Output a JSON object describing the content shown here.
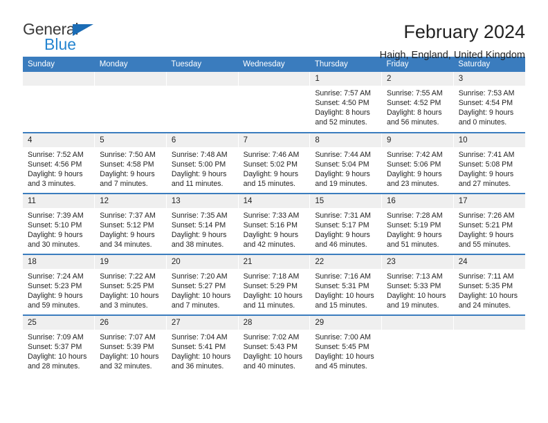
{
  "brand": {
    "name_top": "General",
    "name_bottom": "Blue",
    "triangle_color": "#1b6cb5",
    "blue_color": "#2585d0"
  },
  "header": {
    "title": "February 2024",
    "subtitle": "Haigh, England, United Kingdom"
  },
  "theme": {
    "header_bg": "#3a7cbe",
    "daynum_bg": "#efefef",
    "text": "#222222"
  },
  "weekday_headers": [
    "Sunday",
    "Monday",
    "Tuesday",
    "Wednesday",
    "Thursday",
    "Friday",
    "Saturday"
  ],
  "weeks": [
    [
      {
        "day": "",
        "sunrise": "",
        "sunset": "",
        "daylight_1": "",
        "daylight_2": ""
      },
      {
        "day": "",
        "sunrise": "",
        "sunset": "",
        "daylight_1": "",
        "daylight_2": ""
      },
      {
        "day": "",
        "sunrise": "",
        "sunset": "",
        "daylight_1": "",
        "daylight_2": ""
      },
      {
        "day": "",
        "sunrise": "",
        "sunset": "",
        "daylight_1": "",
        "daylight_2": ""
      },
      {
        "day": "1",
        "sunrise": "Sunrise: 7:57 AM",
        "sunset": "Sunset: 4:50 PM",
        "daylight_1": "Daylight: 8 hours",
        "daylight_2": "and 52 minutes."
      },
      {
        "day": "2",
        "sunrise": "Sunrise: 7:55 AM",
        "sunset": "Sunset: 4:52 PM",
        "daylight_1": "Daylight: 8 hours",
        "daylight_2": "and 56 minutes."
      },
      {
        "day": "3",
        "sunrise": "Sunrise: 7:53 AM",
        "sunset": "Sunset: 4:54 PM",
        "daylight_1": "Daylight: 9 hours",
        "daylight_2": "and 0 minutes."
      }
    ],
    [
      {
        "day": "4",
        "sunrise": "Sunrise: 7:52 AM",
        "sunset": "Sunset: 4:56 PM",
        "daylight_1": "Daylight: 9 hours",
        "daylight_2": "and 3 minutes."
      },
      {
        "day": "5",
        "sunrise": "Sunrise: 7:50 AM",
        "sunset": "Sunset: 4:58 PM",
        "daylight_1": "Daylight: 9 hours",
        "daylight_2": "and 7 minutes."
      },
      {
        "day": "6",
        "sunrise": "Sunrise: 7:48 AM",
        "sunset": "Sunset: 5:00 PM",
        "daylight_1": "Daylight: 9 hours",
        "daylight_2": "and 11 minutes."
      },
      {
        "day": "7",
        "sunrise": "Sunrise: 7:46 AM",
        "sunset": "Sunset: 5:02 PM",
        "daylight_1": "Daylight: 9 hours",
        "daylight_2": "and 15 minutes."
      },
      {
        "day": "8",
        "sunrise": "Sunrise: 7:44 AM",
        "sunset": "Sunset: 5:04 PM",
        "daylight_1": "Daylight: 9 hours",
        "daylight_2": "and 19 minutes."
      },
      {
        "day": "9",
        "sunrise": "Sunrise: 7:42 AM",
        "sunset": "Sunset: 5:06 PM",
        "daylight_1": "Daylight: 9 hours",
        "daylight_2": "and 23 minutes."
      },
      {
        "day": "10",
        "sunrise": "Sunrise: 7:41 AM",
        "sunset": "Sunset: 5:08 PM",
        "daylight_1": "Daylight: 9 hours",
        "daylight_2": "and 27 minutes."
      }
    ],
    [
      {
        "day": "11",
        "sunrise": "Sunrise: 7:39 AM",
        "sunset": "Sunset: 5:10 PM",
        "daylight_1": "Daylight: 9 hours",
        "daylight_2": "and 30 minutes."
      },
      {
        "day": "12",
        "sunrise": "Sunrise: 7:37 AM",
        "sunset": "Sunset: 5:12 PM",
        "daylight_1": "Daylight: 9 hours",
        "daylight_2": "and 34 minutes."
      },
      {
        "day": "13",
        "sunrise": "Sunrise: 7:35 AM",
        "sunset": "Sunset: 5:14 PM",
        "daylight_1": "Daylight: 9 hours",
        "daylight_2": "and 38 minutes."
      },
      {
        "day": "14",
        "sunrise": "Sunrise: 7:33 AM",
        "sunset": "Sunset: 5:16 PM",
        "daylight_1": "Daylight: 9 hours",
        "daylight_2": "and 42 minutes."
      },
      {
        "day": "15",
        "sunrise": "Sunrise: 7:31 AM",
        "sunset": "Sunset: 5:17 PM",
        "daylight_1": "Daylight: 9 hours",
        "daylight_2": "and 46 minutes."
      },
      {
        "day": "16",
        "sunrise": "Sunrise: 7:28 AM",
        "sunset": "Sunset: 5:19 PM",
        "daylight_1": "Daylight: 9 hours",
        "daylight_2": "and 51 minutes."
      },
      {
        "day": "17",
        "sunrise": "Sunrise: 7:26 AM",
        "sunset": "Sunset: 5:21 PM",
        "daylight_1": "Daylight: 9 hours",
        "daylight_2": "and 55 minutes."
      }
    ],
    [
      {
        "day": "18",
        "sunrise": "Sunrise: 7:24 AM",
        "sunset": "Sunset: 5:23 PM",
        "daylight_1": "Daylight: 9 hours",
        "daylight_2": "and 59 minutes."
      },
      {
        "day": "19",
        "sunrise": "Sunrise: 7:22 AM",
        "sunset": "Sunset: 5:25 PM",
        "daylight_1": "Daylight: 10 hours",
        "daylight_2": "and 3 minutes."
      },
      {
        "day": "20",
        "sunrise": "Sunrise: 7:20 AM",
        "sunset": "Sunset: 5:27 PM",
        "daylight_1": "Daylight: 10 hours",
        "daylight_2": "and 7 minutes."
      },
      {
        "day": "21",
        "sunrise": "Sunrise: 7:18 AM",
        "sunset": "Sunset: 5:29 PM",
        "daylight_1": "Daylight: 10 hours",
        "daylight_2": "and 11 minutes."
      },
      {
        "day": "22",
        "sunrise": "Sunrise: 7:16 AM",
        "sunset": "Sunset: 5:31 PM",
        "daylight_1": "Daylight: 10 hours",
        "daylight_2": "and 15 minutes."
      },
      {
        "day": "23",
        "sunrise": "Sunrise: 7:13 AM",
        "sunset": "Sunset: 5:33 PM",
        "daylight_1": "Daylight: 10 hours",
        "daylight_2": "and 19 minutes."
      },
      {
        "day": "24",
        "sunrise": "Sunrise: 7:11 AM",
        "sunset": "Sunset: 5:35 PM",
        "daylight_1": "Daylight: 10 hours",
        "daylight_2": "and 24 minutes."
      }
    ],
    [
      {
        "day": "25",
        "sunrise": "Sunrise: 7:09 AM",
        "sunset": "Sunset: 5:37 PM",
        "daylight_1": "Daylight: 10 hours",
        "daylight_2": "and 28 minutes."
      },
      {
        "day": "26",
        "sunrise": "Sunrise: 7:07 AM",
        "sunset": "Sunset: 5:39 PM",
        "daylight_1": "Daylight: 10 hours",
        "daylight_2": "and 32 minutes."
      },
      {
        "day": "27",
        "sunrise": "Sunrise: 7:04 AM",
        "sunset": "Sunset: 5:41 PM",
        "daylight_1": "Daylight: 10 hours",
        "daylight_2": "and 36 minutes."
      },
      {
        "day": "28",
        "sunrise": "Sunrise: 7:02 AM",
        "sunset": "Sunset: 5:43 PM",
        "daylight_1": "Daylight: 10 hours",
        "daylight_2": "and 40 minutes."
      },
      {
        "day": "29",
        "sunrise": "Sunrise: 7:00 AM",
        "sunset": "Sunset: 5:45 PM",
        "daylight_1": "Daylight: 10 hours",
        "daylight_2": "and 45 minutes."
      },
      {
        "day": "",
        "sunrise": "",
        "sunset": "",
        "daylight_1": "",
        "daylight_2": ""
      },
      {
        "day": "",
        "sunrise": "",
        "sunset": "",
        "daylight_1": "",
        "daylight_2": ""
      }
    ]
  ]
}
